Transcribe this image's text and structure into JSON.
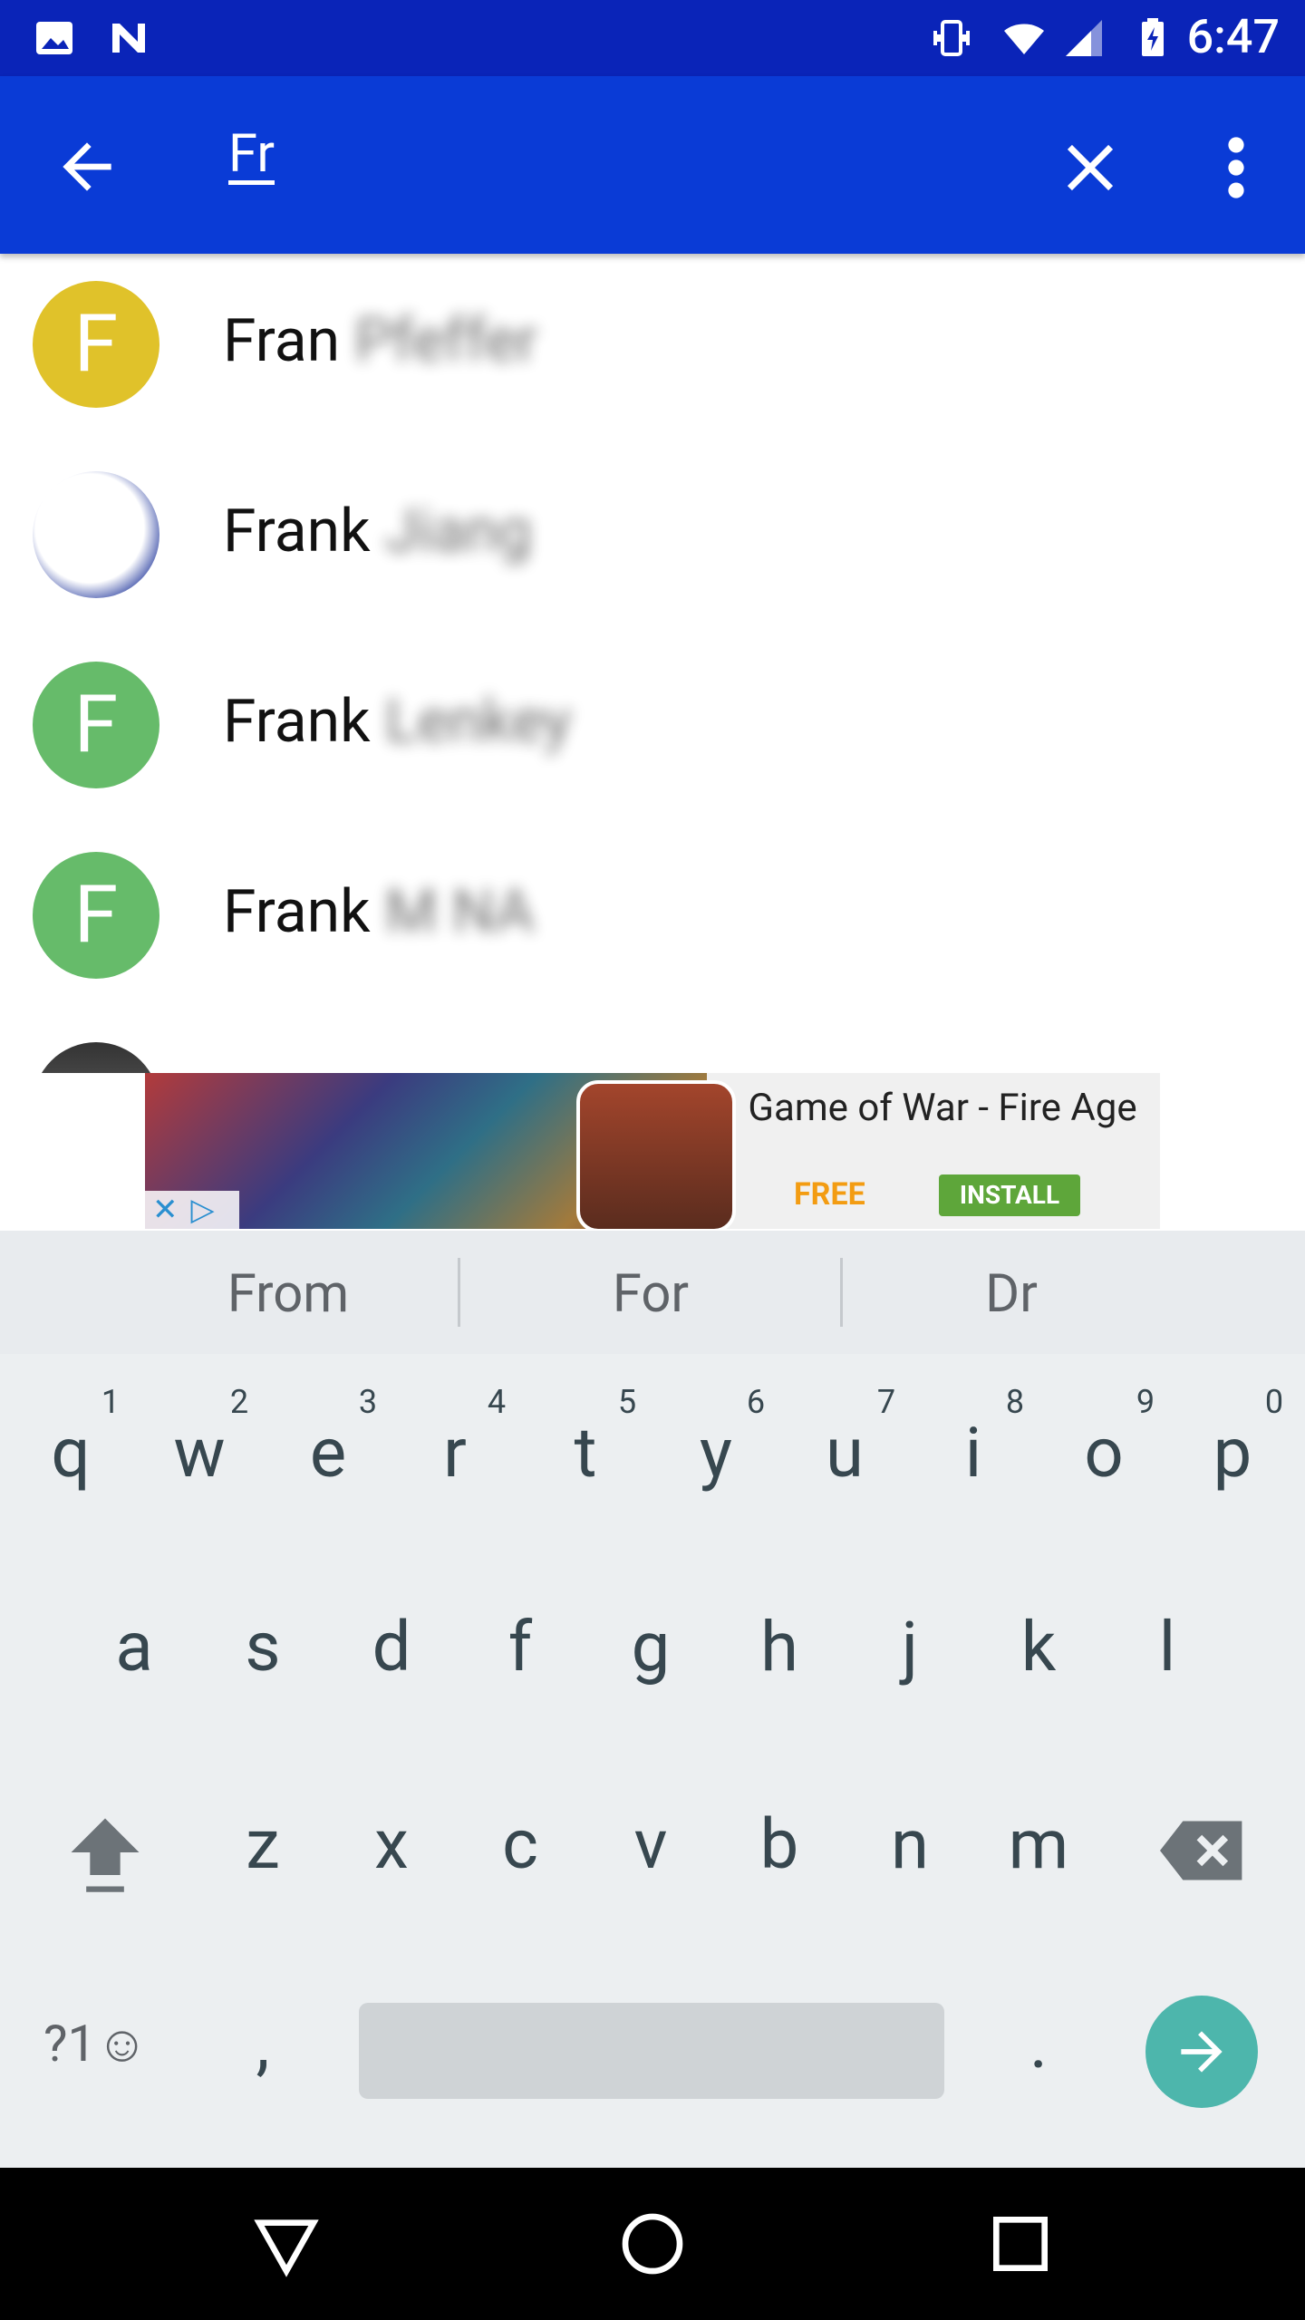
{
  "status_bar": {
    "time": "6:47"
  },
  "search": {
    "query": "Fr"
  },
  "contacts": [
    {
      "initial": "F",
      "name": "Fran",
      "hidden": "Pfeffer",
      "color": "#e0c22a"
    },
    {
      "initial": "",
      "name": "Frank",
      "hidden": "Jiang",
      "color": "#ffffff"
    },
    {
      "initial": "F",
      "name": "Frank",
      "hidden": "Lenkey",
      "color": "#66bb6a"
    },
    {
      "initial": "F",
      "name": "Frank",
      "hidden": "M NA",
      "color": "#66bb6a"
    }
  ],
  "ad": {
    "title": "Game of War - Fire Age",
    "price": "FREE",
    "install": "INSTALL"
  },
  "suggestions": [
    "From",
    "For",
    "Dr"
  ],
  "keyboard": {
    "row1": [
      "q",
      "w",
      "e",
      "r",
      "t",
      "y",
      "u",
      "i",
      "o",
      "p"
    ],
    "row1_hints": [
      "1",
      "2",
      "3",
      "4",
      "5",
      "6",
      "7",
      "8",
      "9",
      "0"
    ],
    "row2": [
      "a",
      "s",
      "d",
      "f",
      "g",
      "h",
      "j",
      "k",
      "l"
    ],
    "row3": [
      "z",
      "x",
      "c",
      "v",
      "b",
      "n",
      "m"
    ],
    "symbols": "?1☺",
    "comma": ",",
    "period": "."
  },
  "colors": {
    "status_bar": "#0a24b8",
    "app_bar": "#0a3bd6",
    "accent": "#4db6ac"
  }
}
